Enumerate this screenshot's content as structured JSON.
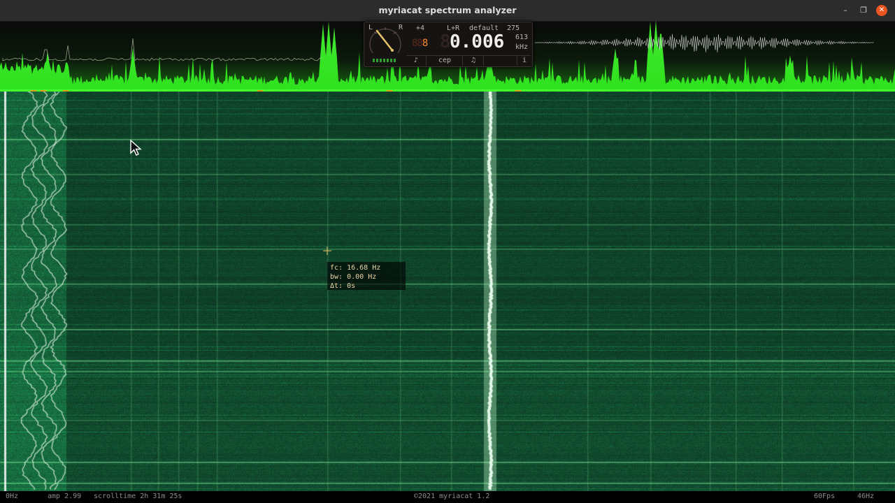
{
  "window": {
    "title": "myriacat spectrum analyzer",
    "controls": {
      "minimize": "–",
      "maximize": "❐",
      "close": "✕"
    }
  },
  "panel": {
    "channel_left": "L",
    "channel_right": "R",
    "gain": "+4",
    "mode": "L+R",
    "preset": "default",
    "count": "275",
    "digits_small_dim": "88",
    "digits_small_lit": "8",
    "frequency": "0.006",
    "frequency_sub": "613",
    "frequency_unit": "kHz",
    "tabs": {
      "pitch": "♪",
      "cepstrum": "cep",
      "note": "♫",
      "info": "i"
    }
  },
  "tooltip": {
    "fc_label": "fc",
    "fc_value": "16.68 Hz",
    "bw_label": "bw",
    "bw_value": "0.00 Hz",
    "dt_label": "Δt",
    "dt_value": "0s"
  },
  "status": {
    "freq_min": "0Hz",
    "amp": "amp 2.99",
    "scrolltime": "scrolltime 2h 31m 25s",
    "copyright": "©2021 myriacat 1.2",
    "fps": "60Fps",
    "freq_max": "46Hz"
  },
  "colors": {
    "accent_green": "#3aff2a",
    "waterfall_base": "#0e4a2c",
    "marker": "#d4a017",
    "close_button": "#e95420"
  }
}
